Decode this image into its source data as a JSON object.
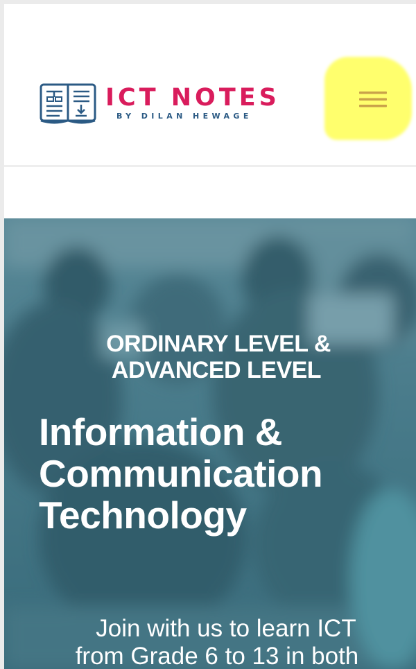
{
  "header": {
    "logo": {
      "title": "ICT NOTES",
      "subtitle": "BY DILAN HEWAGE",
      "icon": "book-download-icon",
      "brand_color": "#d91c5c",
      "sub_color": "#2b5a84"
    },
    "menu_button": {
      "icon": "hamburger-menu-icon",
      "icon_color": "#c9a24a",
      "highlight_color": "#ffff66"
    }
  },
  "hero": {
    "kicker_line1": "ORDINARY LEVEL &",
    "kicker_line2": "ADVANCED LEVEL",
    "title_line1": "Information &",
    "title_line2": "Communication",
    "title_line3": "Technology",
    "text_line1": "Join with us to learn ICT",
    "text_line2": "from Grade 6 to 13 in both"
  }
}
